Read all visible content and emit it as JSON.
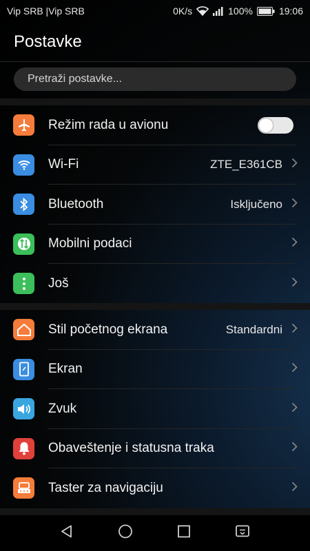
{
  "status_bar": {
    "carrier": "Vip SRB |Vip SRB",
    "speed": "0K/s",
    "battery": "100%",
    "time": "19:06",
    "icons": [
      "wifi-icon",
      "signal-icon",
      "battery-icon"
    ]
  },
  "app_bar": {
    "title": "Postavke"
  },
  "search": {
    "placeholder": "Pretraži postavke..."
  },
  "section1": [
    {
      "label": "Režim rada u avionu",
      "icon": "airplane-icon",
      "icon_color": "#f57c3a",
      "toggle": true,
      "toggle_on": false
    },
    {
      "label": "Wi-Fi",
      "value": "ZTE_E361CB",
      "icon": "wifi-icon",
      "icon_color": "#3a8de0"
    },
    {
      "label": "Bluetooth",
      "value": "Isključeno",
      "icon": "bluetooth-icon",
      "icon_color": "#3a8de0"
    },
    {
      "label": "Mobilni podaci",
      "icon": "mobile-data-icon",
      "icon_color": "#3cbf5a"
    },
    {
      "label": "Još",
      "icon": "more-icon",
      "icon_color": "#3cbf5a"
    }
  ],
  "section2": [
    {
      "label": "Stil početnog ekrana",
      "value": "Standardni",
      "icon": "home-icon",
      "icon_color": "#f57c3a"
    },
    {
      "label": "Ekran",
      "icon": "display-icon",
      "icon_color": "#3a8de0"
    },
    {
      "label": "Zvuk",
      "icon": "speaker-icon",
      "icon_color": "#3aa6e0"
    },
    {
      "label": "Obaveštenje i statusna traka",
      "icon": "bell-icon",
      "icon_color": "#e0413a"
    },
    {
      "label": "Taster za navigaciju",
      "icon": "navigation-key-icon",
      "icon_color": "#f57c3a"
    }
  ],
  "nav_bar": {
    "buttons": [
      "back-icon",
      "home-circle-icon",
      "recents-icon",
      "notification-shade-icon"
    ]
  }
}
